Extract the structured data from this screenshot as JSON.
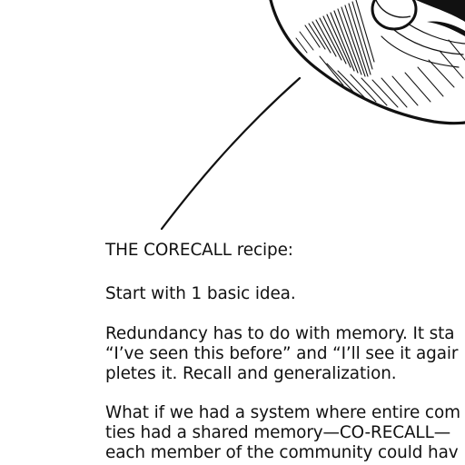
{
  "document": {
    "heading": "THE CORECALL recipe:",
    "paragraphs": [
      {
        "lines": [
          "Start with 1 basic idea."
        ]
      },
      {
        "lines": [
          "Redundancy has to do with memory. It sta",
          "“I’ve seen this before” and “I’ll see it agair",
          "pletes it. Recall and generalization."
        ]
      },
      {
        "lines": [
          "What if we had a system where entire com",
          "ties had a shared memory—CO-RECALL—",
          "each member of the community could hav"
        ]
      }
    ]
  },
  "illustration": {
    "description_icon": "circle-illustration-icon",
    "ink_color": "#111111",
    "paper_color": "#ffffff"
  }
}
